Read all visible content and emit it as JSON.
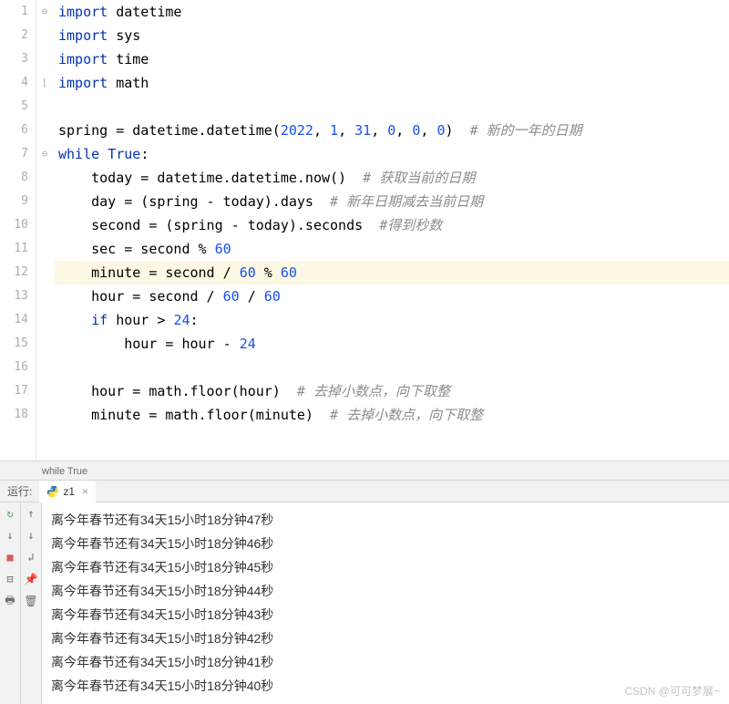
{
  "editor": {
    "lines": [
      {
        "n": "1",
        "fold": "⊖",
        "indent": 0,
        "tokens": [
          {
            "t": "import",
            "c": "kw"
          },
          {
            "t": " datetime",
            "c": "ident"
          }
        ]
      },
      {
        "n": "2",
        "fold": "",
        "indent": 0,
        "tokens": [
          {
            "t": "import",
            "c": "kw"
          },
          {
            "t": " sys",
            "c": "ident"
          }
        ]
      },
      {
        "n": "3",
        "fold": "",
        "indent": 0,
        "tokens": [
          {
            "t": "import",
            "c": "kw"
          },
          {
            "t": " time",
            "c": "ident"
          }
        ]
      },
      {
        "n": "4",
        "fold": "⌊",
        "indent": 0,
        "tokens": [
          {
            "t": "import",
            "c": "kw"
          },
          {
            "t": " math",
            "c": "ident"
          }
        ]
      },
      {
        "n": "5",
        "fold": "",
        "indent": 0,
        "tokens": []
      },
      {
        "n": "6",
        "fold": "",
        "indent": 0,
        "tokens": [
          {
            "t": "spring = datetime.datetime(",
            "c": "ident"
          },
          {
            "t": "2022",
            "c": "num"
          },
          {
            "t": ", ",
            "c": "ident"
          },
          {
            "t": "1",
            "c": "num"
          },
          {
            "t": ", ",
            "c": "ident"
          },
          {
            "t": "31",
            "c": "num"
          },
          {
            "t": ", ",
            "c": "ident"
          },
          {
            "t": "0",
            "c": "num"
          },
          {
            "t": ", ",
            "c": "ident"
          },
          {
            "t": "0",
            "c": "num"
          },
          {
            "t": ", ",
            "c": "ident"
          },
          {
            "t": "0",
            "c": "num"
          },
          {
            "t": ")  ",
            "c": "ident"
          },
          {
            "t": "# 新的一年的日期",
            "c": "cmt"
          }
        ]
      },
      {
        "n": "7",
        "fold": "⊖",
        "indent": 0,
        "tokens": [
          {
            "t": "while ",
            "c": "kw"
          },
          {
            "t": "True",
            "c": "kw"
          },
          {
            "t": ":",
            "c": "ident"
          }
        ]
      },
      {
        "n": "8",
        "fold": "",
        "indent": 1,
        "tokens": [
          {
            "t": "today = datetime.datetime.now()  ",
            "c": "ident"
          },
          {
            "t": "# 获取当前的日期",
            "c": "cmt"
          }
        ]
      },
      {
        "n": "9",
        "fold": "",
        "indent": 1,
        "tokens": [
          {
            "t": "day = (spring - today).days  ",
            "c": "ident"
          },
          {
            "t": "# 新年日期减去当前日期",
            "c": "cmt"
          }
        ]
      },
      {
        "n": "10",
        "fold": "",
        "indent": 1,
        "tokens": [
          {
            "t": "second = (spring - today).seconds  ",
            "c": "ident"
          },
          {
            "t": "#得到秒数",
            "c": "cmt"
          }
        ]
      },
      {
        "n": "11",
        "fold": "",
        "indent": 1,
        "tokens": [
          {
            "t": "sec = second % ",
            "c": "ident"
          },
          {
            "t": "60",
            "c": "num"
          }
        ]
      },
      {
        "n": "12",
        "fold": "",
        "indent": 1,
        "hl": true,
        "tokens": [
          {
            "t": "minute = second / ",
            "c": "ident"
          },
          {
            "t": "60",
            "c": "num"
          },
          {
            "t": " % ",
            "c": "ident"
          },
          {
            "t": "60",
            "c": "num"
          }
        ]
      },
      {
        "n": "13",
        "fold": "",
        "indent": 1,
        "tokens": [
          {
            "t": "hour = second / ",
            "c": "ident"
          },
          {
            "t": "60",
            "c": "num"
          },
          {
            "t": " / ",
            "c": "ident"
          },
          {
            "t": "60",
            "c": "num"
          }
        ]
      },
      {
        "n": "14",
        "fold": "",
        "indent": 1,
        "tokens": [
          {
            "t": "if ",
            "c": "kw"
          },
          {
            "t": "hour > ",
            "c": "ident"
          },
          {
            "t": "24",
            "c": "num"
          },
          {
            "t": ":",
            "c": "ident"
          }
        ]
      },
      {
        "n": "15",
        "fold": "",
        "indent": 2,
        "tokens": [
          {
            "t": "hour = hour - ",
            "c": "ident"
          },
          {
            "t": "24",
            "c": "num"
          }
        ]
      },
      {
        "n": "16",
        "fold": "",
        "indent": 0,
        "tokens": []
      },
      {
        "n": "17",
        "fold": "",
        "indent": 1,
        "tokens": [
          {
            "t": "hour = math.floor(hour)  ",
            "c": "ident"
          },
          {
            "t": "# 去掉小数点，向下取整",
            "c": "cmt"
          }
        ]
      },
      {
        "n": "18",
        "fold": "",
        "indent": 1,
        "tokens": [
          {
            "t": "minute = math.floor(minute)  ",
            "c": "ident"
          },
          {
            "t": "# 去掉小数点，向下取整",
            "c": "cmt"
          }
        ]
      }
    ]
  },
  "breadcrumb": {
    "text": "while True"
  },
  "run": {
    "label": "运行:",
    "tab_name": "z1"
  },
  "toolbar": {
    "rerun": "↻",
    "down": "↓",
    "stop": "■",
    "layout": "⊟",
    "print": "🖶",
    "pin": "📌",
    "trash": "🗑"
  },
  "console": {
    "lines": [
      "离今年春节还有34天15小时18分钟47秒",
      "离今年春节还有34天15小时18分钟46秒",
      "离今年春节还有34天15小时18分钟45秒",
      "离今年春节还有34天15小时18分钟44秒",
      "离今年春节还有34天15小时18分钟43秒",
      "离今年春节还有34天15小时18分钟42秒",
      "离今年春节还有34天15小时18分钟41秒",
      "离今年春节还有34天15小时18分钟40秒"
    ]
  },
  "watermark": "CSDN @可可梦展~"
}
